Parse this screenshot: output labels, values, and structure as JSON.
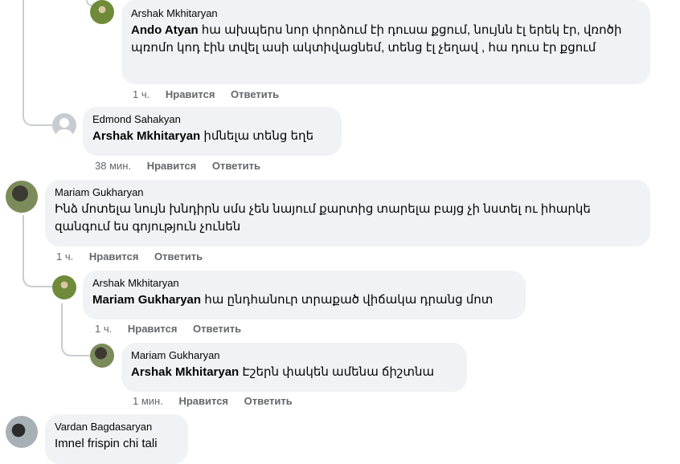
{
  "comments": [
    {
      "author": "Arshak Mkhitaryan",
      "mention": "Ando Atyan",
      "text": " հա ախպերս նոր փորձում էի դուսա քցում, նույնն էլ երեկ էր, վռոծի պռոմո կոդ էին տվել ասի ակտիվացնեմ, տենց էլ չեղավ , հա դուս էր քցում",
      "time": "1 ч.",
      "like": "Нравится",
      "reply": "Ответить"
    },
    {
      "author": "Edmond Sahakyan",
      "mention": "Arshak Mkhitaryan",
      "text": " իմնելա տենց եղե",
      "time": "38 мин.",
      "like": "Нравится",
      "reply": "Ответить"
    },
    {
      "author": "Mariam Gukharyan",
      "mention": "",
      "text": "Ինձ մոտելա նույն խնդիրն սմս չեն նայում քարտից տարելա բայց չի նստել ու իհարկե զանգում ես գոյություն չունեն",
      "time": "1 ч.",
      "like": "Нравится",
      "reply": "Ответить"
    },
    {
      "author": "Arshak Mkhitaryan",
      "mention": "Mariam Gukharyan",
      "text": " հա ընդհանուր տրաքած վիճակա դրանց մոտ",
      "time": "1 ч.",
      "like": "Нравится",
      "reply": "Ответить"
    },
    {
      "author": "Mariam Gukharyan",
      "mention": "Arshak Mkhitaryan",
      "text": " Էշերն փակեն ամենա ճիշտնա",
      "time": "1 мин.",
      "like": "Нравится",
      "reply": "Ответить"
    },
    {
      "author": "Vardan Bagdasaryan",
      "mention": "",
      "text": "Imnel frispin chi tali"
    }
  ]
}
